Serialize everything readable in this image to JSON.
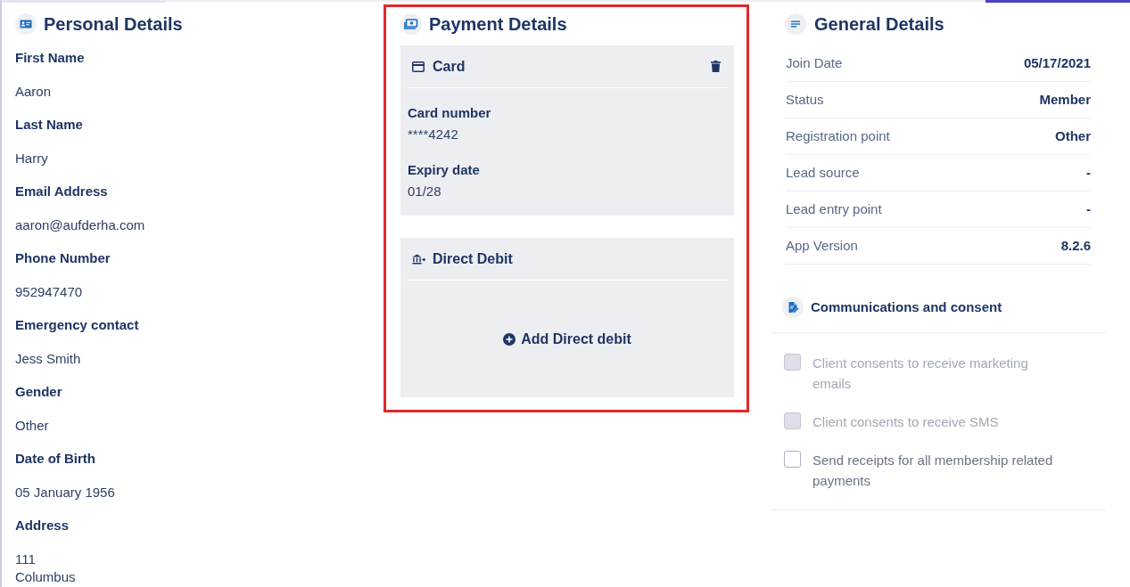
{
  "personal_details": {
    "title": "Personal Details",
    "fields": [
      {
        "label": "First Name",
        "value": "Aaron"
      },
      {
        "label": "Last Name",
        "value": "Harry"
      },
      {
        "label": "Email Address",
        "value": "aaron@aufderha.com"
      },
      {
        "label": "Phone Number",
        "value": "952947470"
      },
      {
        "label": "Emergency contact",
        "value": "Jess Smith"
      },
      {
        "label": "Gender",
        "value": "Other"
      },
      {
        "label": "Date of Birth",
        "value": "05 January 1956"
      },
      {
        "label": "Address",
        "value": "111\nColumbus"
      }
    ]
  },
  "payment_details": {
    "title": "Payment Details",
    "highlighted": true,
    "card": {
      "title": "Card",
      "fields": [
        {
          "label": "Card number",
          "value": "****4242"
        },
        {
          "label": "Expiry date",
          "value": "01/28"
        }
      ]
    },
    "direct_debit": {
      "title": "Direct Debit",
      "add_button": "Add Direct debit"
    }
  },
  "general_details": {
    "title": "General Details",
    "rows": [
      {
        "label": "Join Date",
        "value": "05/17/2021"
      },
      {
        "label": "Status",
        "value": "Member"
      },
      {
        "label": "Registration point",
        "value": "Other"
      },
      {
        "label": "Lead source",
        "value": "-"
      },
      {
        "label": "Lead entry point",
        "value": "-"
      },
      {
        "label": "App Version",
        "value": "8.2.6"
      }
    ]
  },
  "communications": {
    "title": "Communications and consent",
    "options": [
      {
        "label": "Client consents to receive marketing emails",
        "checked": false,
        "disabled": true
      },
      {
        "label": "Client consents to receive SMS",
        "checked": false,
        "disabled": true
      },
      {
        "label": "Send receipts for all membership related payments",
        "checked": false,
        "disabled": false
      }
    ]
  }
}
